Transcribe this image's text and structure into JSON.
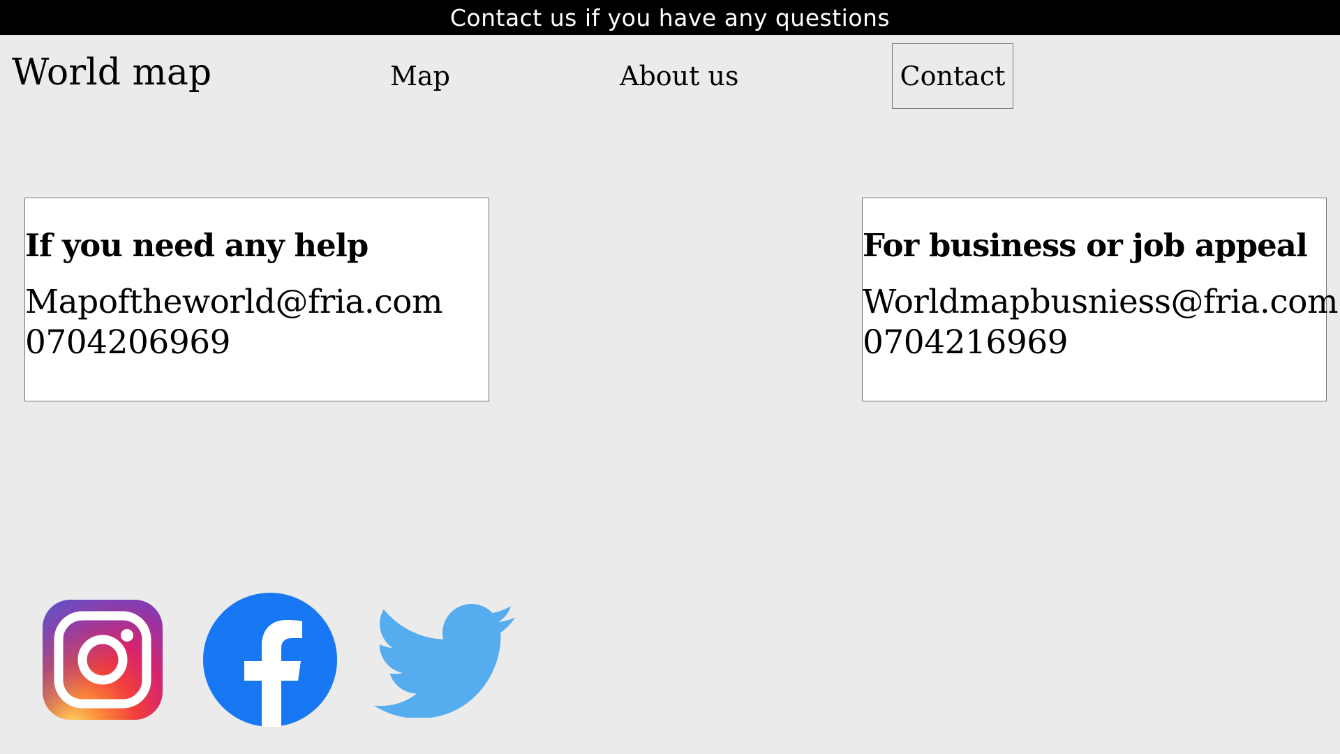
{
  "banner": {
    "text": "Contact us if you have any questions"
  },
  "header": {
    "logo": "World map",
    "nav": {
      "map": "Map",
      "about": "About us",
      "contact": "Contact"
    }
  },
  "cards": {
    "help": {
      "heading": "If you need any help",
      "email": "Mapoftheworld@fria.com",
      "phone": "0704206969"
    },
    "business": {
      "heading": "For business or job appeal",
      "email": "Worldmapbusniess@fria.com",
      "phone": "0704216969"
    }
  },
  "social": {
    "icons": [
      "instagram-icon",
      "facebook-icon",
      "twitter-icon"
    ],
    "colors": {
      "facebook": "#1877f2",
      "twitter": "#55acee"
    }
  },
  "colors": {
    "page_background": "#ebebeb",
    "banner_background": "#000000",
    "card_background": "#ffffff"
  }
}
